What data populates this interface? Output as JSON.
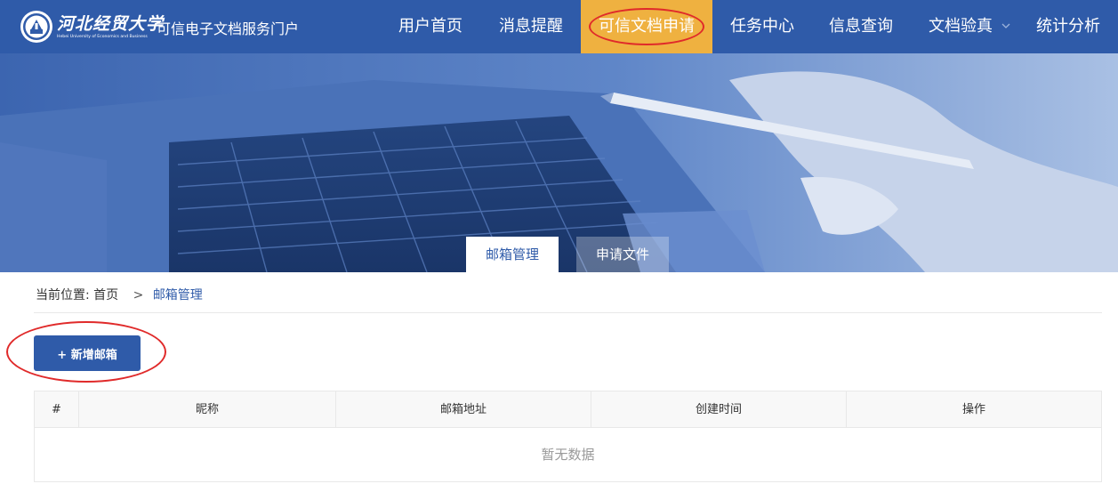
{
  "header": {
    "logo_name": "河北经贸大学",
    "logo_english": "Hebei University of Economics and Business",
    "portal_title": "可信电子文档服务门户",
    "nav": [
      {
        "label": "用户首页"
      },
      {
        "label": "消息提醒"
      },
      {
        "label": "可信文档申请",
        "active": true
      },
      {
        "label": "任务中心"
      },
      {
        "label": "信息查询"
      },
      {
        "label": "文档验真",
        "has_dropdown": true
      },
      {
        "label": "统计分析"
      }
    ]
  },
  "banner": {
    "tabs": [
      {
        "label": "邮箱管理",
        "active": true
      },
      {
        "label": "申请文件",
        "active": false
      }
    ]
  },
  "breadcrumb": {
    "prefix": "当前位置:",
    "home": "首页",
    "separator": ">",
    "current": "邮箱管理"
  },
  "toolbar": {
    "add_label": "+ 新增邮箱"
  },
  "table": {
    "columns": [
      "#",
      "昵称",
      "邮箱地址",
      "创建时间",
      "操作"
    ],
    "empty_text": "暂无数据"
  },
  "colors": {
    "primary": "#2f5ba9",
    "active_nav": "#efb140",
    "annotation": "#e02a2a"
  }
}
